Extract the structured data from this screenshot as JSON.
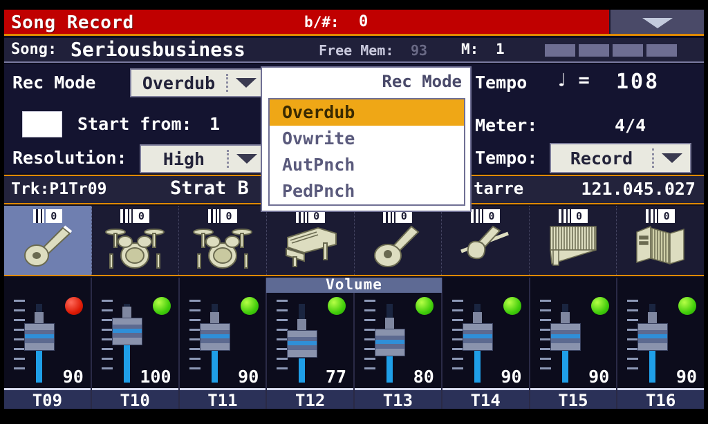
{
  "titlebar": {
    "title": "Song Record",
    "bsharp_label": "b/#:",
    "bsharp_value": "0",
    "page_menu_icon": "chevron-down-icon"
  },
  "songrow": {
    "song_label": "Song:",
    "song_name": "Seriousbusiness",
    "freemem_label": "Free Mem:",
    "freemem_value": "93",
    "measure_label": "M:",
    "measure_value": "1",
    "beat_boxes": 4
  },
  "settings": {
    "rec_mode_label": "Rec Mode",
    "rec_mode_value": "Overdub",
    "start_from_label": "Start from:",
    "start_from_value": "1",
    "start_from_checked": false,
    "resolution_label": "Resolution:",
    "resolution_value": "High",
    "tempo_label": "Tempo",
    "tempo_note": "♩ =",
    "tempo_value": "108",
    "meter_label": "Meter:",
    "meter_value": "4/4",
    "tempo_mode_label": "Tempo:",
    "tempo_mode_value": "Record"
  },
  "popup": {
    "title": "Rec Mode",
    "items": [
      {
        "label": "Overdub",
        "selected": true
      },
      {
        "label": "Ovwrite",
        "selected": false
      },
      {
        "label": "AutPnch",
        "selected": false
      },
      {
        "label": "PedPnch",
        "selected": false
      }
    ]
  },
  "track_info": {
    "trk_label": "Trk:P1Tr09",
    "sound_name": "Strat B",
    "sound_name_cont": "tarre",
    "position": "121.045.027"
  },
  "volume_header": "Volume",
  "tracks": [
    {
      "label": "T09",
      "volume": 90,
      "led": "red",
      "icon": "electric-guitar-icon",
      "midi_channel": "0",
      "selected": true
    },
    {
      "label": "T10",
      "volume": 100,
      "led": "green",
      "icon": "drumkit-icon",
      "midi_channel": "0",
      "selected": false
    },
    {
      "label": "T11",
      "volume": 90,
      "led": "green",
      "icon": "drumkit-icon",
      "midi_channel": "0",
      "selected": false
    },
    {
      "label": "T12",
      "volume": 77,
      "led": "green",
      "icon": "piano-icon",
      "midi_channel": "0",
      "selected": false
    },
    {
      "label": "T13",
      "volume": 80,
      "led": "green",
      "icon": "acoustic-guitar-icon",
      "midi_channel": "0",
      "selected": false
    },
    {
      "label": "T14",
      "volume": 90,
      "led": "green",
      "icon": "violin-icon",
      "midi_channel": "0",
      "selected": false
    },
    {
      "label": "T15",
      "volume": 90,
      "led": "green",
      "icon": "harp-icon",
      "midi_channel": "0",
      "selected": false
    },
    {
      "label": "T16",
      "volume": 90,
      "led": "green",
      "icon": "accordion-icon",
      "midi_channel": "0",
      "selected": false
    }
  ],
  "colors": {
    "title_bar": "#c00000",
    "accent_orange": "#e08a00",
    "highlight": "#efa716",
    "fader_blue": "#1f9fe8",
    "led_green": "#3fcc0a",
    "led_red": "#dd1a05"
  }
}
